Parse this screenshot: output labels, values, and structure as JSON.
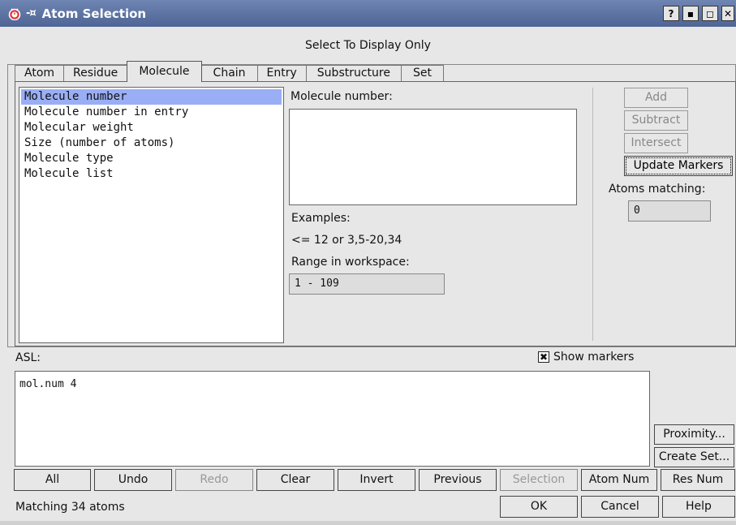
{
  "window": {
    "title": "Atom Selection",
    "pin_glyph": "-¤",
    "title_buttons": [
      "?",
      "▪",
      "◻",
      "✕"
    ]
  },
  "subtitle": "Select To Display Only",
  "tabs": [
    {
      "label": "Atom",
      "active": false
    },
    {
      "label": "Residue",
      "active": false
    },
    {
      "label": "Molecule",
      "active": true
    },
    {
      "label": "Chain",
      "active": false
    },
    {
      "label": "Entry",
      "active": false
    },
    {
      "label": "Substructure",
      "active": false
    },
    {
      "label": "Set",
      "active": false
    }
  ],
  "property_list": [
    {
      "label": "Molecule number",
      "selected": true
    },
    {
      "label": "Molecule number in entry",
      "selected": false
    },
    {
      "label": "Molecular weight",
      "selected": false
    },
    {
      "label": "Size (number of atoms)",
      "selected": false
    },
    {
      "label": "Molecule type",
      "selected": false
    },
    {
      "label": "Molecule list",
      "selected": false
    }
  ],
  "criteria": {
    "label": "Molecule number:",
    "value": "",
    "examples_label": "Examples:",
    "examples_text": "<= 12 or 3,5-20,34",
    "range_label": "Range in workspace:",
    "range_value": "1 - 109"
  },
  "side_buttons": {
    "add": "Add",
    "subtract": "Subtract",
    "intersect": "Intersect",
    "update_markers": "Update Markers",
    "atoms_matching_label": "Atoms matching:",
    "atoms_matching_value": "0"
  },
  "asl": {
    "label": "ASL:",
    "show_markers_label": "Show markers",
    "show_markers_checked": true,
    "checkbox_glyph": "✖",
    "value": "mol.num 4"
  },
  "asl_buttons": {
    "proximity": "Proximity...",
    "create_set": "Create Set..."
  },
  "bottom_buttons": {
    "all": "All",
    "undo": "Undo",
    "redo": "Redo",
    "clear": "Clear",
    "invert": "Invert",
    "previous": "Previous",
    "selection": "Selection",
    "atom_num": "Atom Num",
    "res_num": "Res Num"
  },
  "footer": {
    "status": "Matching 34 atoms",
    "ok": "OK",
    "cancel": "Cancel",
    "help": "Help"
  }
}
